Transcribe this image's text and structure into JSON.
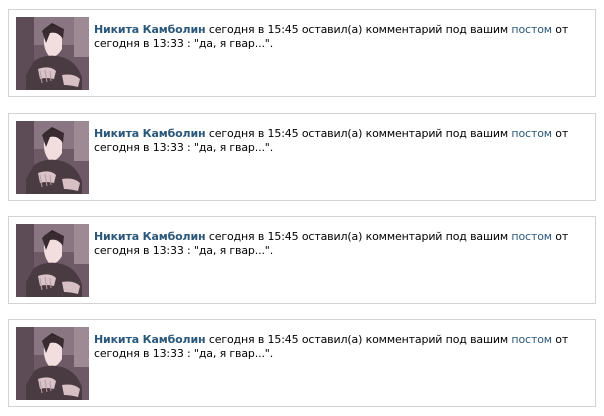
{
  "notifications": [
    {
      "author": "Никита Камболин",
      "before_link": " сегодня в 15:45 оставил(а) комментарий под вашим ",
      "link": "постом",
      "after_link": " от сегодня в 13:33 : \"да, я гвар...\"."
    },
    {
      "author": "Никита Камболин",
      "before_link": " сегодня в 15:45 оставил(а) комментарий под вашим ",
      "link": "постом",
      "after_link": " от сегодня в 13:33 : \"да, я гвар...\"."
    },
    {
      "author": "Никита Камболин",
      "before_link": " сегодня в 15:45 оставил(а) комментарий под вашим ",
      "link": "постом",
      "after_link": " от сегодня в 13:33 : \"да, я гвар...\"."
    },
    {
      "author": "Никита Камболин",
      "before_link": " сегодня в 15:45 оставил(а) комментарий под вашим ",
      "link": "постом",
      "after_link": " от сегодня в 13:33 : \"да, я гвар...\"."
    }
  ],
  "colors": {
    "link": "#2b587a",
    "border": "#d3d3d3",
    "text": "#000000"
  },
  "icons": {
    "avatar": "user-photo-avatar"
  }
}
